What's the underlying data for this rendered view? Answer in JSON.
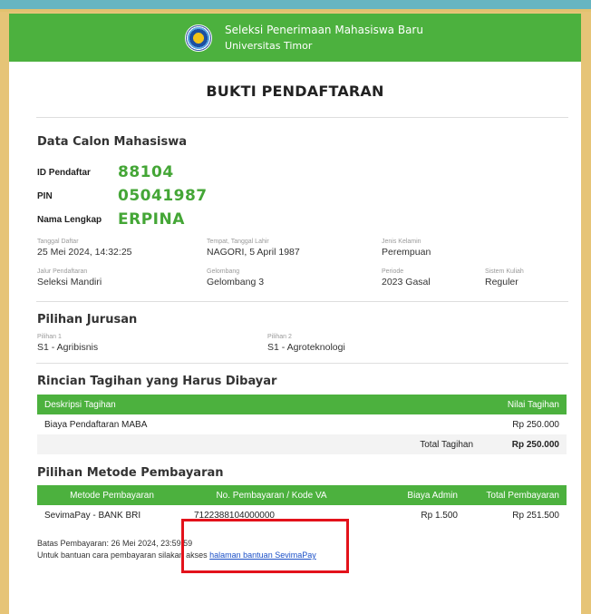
{
  "header": {
    "line1": "Seleksi Penerimaan Mahasiswa Baru",
    "line2": "Universitas Timor"
  },
  "title": "BUKTI PENDAFTARAN",
  "candidate": {
    "section_title": "Data Calon Mahasiswa",
    "id_label": "ID Pendaftar",
    "id_value": "88104",
    "pin_label": "PIN",
    "pin_value": "05041987",
    "name_label": "Nama Lengkap",
    "name_value": "ERPINA",
    "tanggal_daftar_label": "Tanggal Daftar",
    "tanggal_daftar_value": "25 Mei 2024, 14:32:25",
    "ttl_label": "Tempat, Tanggal Lahir",
    "ttl_value": "NAGORI, 5 April 1987",
    "jk_label": "Jenis Kelamin",
    "jk_value": "Perempuan",
    "jalur_label": "Jalur Pendaftaran",
    "jalur_value": "Seleksi Mandiri",
    "gelombang_label": "Gelombang",
    "gelombang_value": "Gelombang 3",
    "periode_label": "Periode",
    "periode_value": "2023 Gasal",
    "sistem_label": "Sistem Kuliah",
    "sistem_value": "Reguler"
  },
  "jurusan": {
    "section_title": "Pilihan Jurusan",
    "pilihan1_label": "Pilihan 1",
    "pilihan1_value": "S1 - Agribisnis",
    "pilihan2_label": "Pilihan 2",
    "pilihan2_value": "S1 - Agroteknologi"
  },
  "tagihan": {
    "section_title": "Rincian Tagihan yang Harus Dibayar",
    "col_desc": "Deskripsi Tagihan",
    "col_nilai": "Nilai Tagihan",
    "row_desc": "Biaya Pendaftaran MABA",
    "row_nilai": "Rp 250.000",
    "total_label": "Total Tagihan",
    "total_value": "Rp 250.000"
  },
  "pembayaran": {
    "section_title": "Pilihan Metode Pembayaran",
    "col_metode": "Metode Pembayaran",
    "col_kode": "No. Pembayaran / Kode VA",
    "col_admin": "Biaya Admin",
    "col_total": "Total Pembayaran",
    "row_metode": "SevimaPay - BANK BRI",
    "row_kode": "7122388104000000",
    "row_admin": "Rp 1.500",
    "row_total": "Rp 251.500"
  },
  "footer": {
    "batas": "Batas Pembayaran: 26 Mei 2024, 23:59:59",
    "bantuan_prefix": "Untuk bantuan cara pembayaran silakan akses",
    "bantuan_link": "halaman bantuan SevimaPay"
  },
  "colors": {
    "green": "#4cb13e",
    "highlight_border": "#e3121b",
    "link": "#1a4fc7"
  }
}
